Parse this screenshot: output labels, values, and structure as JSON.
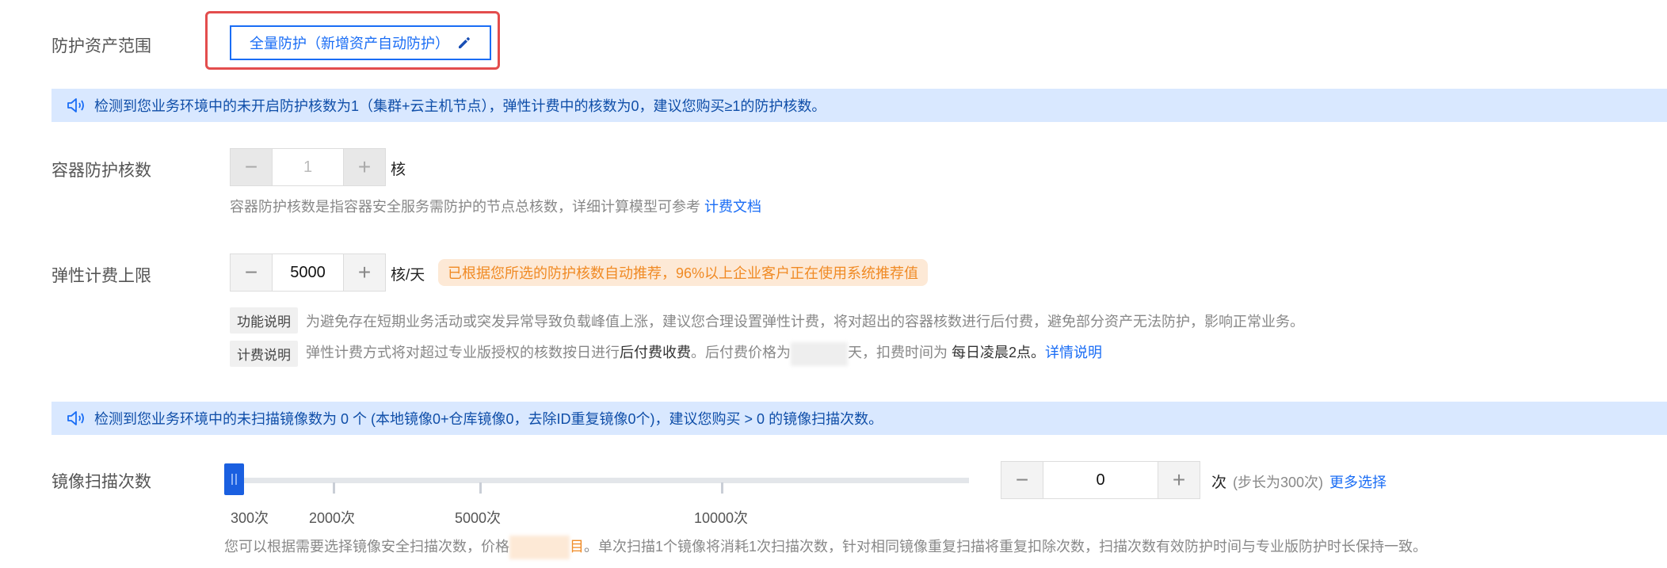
{
  "scope": {
    "label": "防护资产范围",
    "button_label": "全量防护（新增资产自动防护）"
  },
  "notice1": {
    "text": "检测到您业务环境中的未开启防护核数为1（集群+云主机节点），弹性计费中的核数为0，建议您购买≥1的防护核数。"
  },
  "container_cores": {
    "label": "容器防护核数",
    "value": "1",
    "unit": "核",
    "hint": "容器防护核数是指容器安全服务需防护的节点总核数，详细计算模型可参考",
    "hint_link": "计费文档"
  },
  "elastic": {
    "label": "弹性计费上限",
    "value": "5000",
    "unit": "核/天",
    "badge": "已根据您所选的防护核数自动推荐，96%以上企业客户正在使用系统推荐值",
    "func_tag": "功能说明",
    "func_text": "为避免存在短期业务活动或突发异常导致负载峰值上涨，建议您合理设置弹性计费，将对超出的容器核数进行后付费，避免部分资产无法防护，影响正常业务。",
    "billing_tag": "计费说明",
    "billing_text_1": "弹性计费方式将对超过专业版授权的核数按日进行",
    "billing_bold_1": "后付费收费",
    "billing_text_2": "。后付费价格为",
    "billing_text_3": "天，扣费时间为",
    "billing_bold_2": "每日凌晨2点",
    "billing_text_4": "。",
    "billing_link": "详情说明"
  },
  "notice2": {
    "text": "检测到您业务环境中的未扫描镜像数为 0 个 (本地镜像0+仓库镜像0，去除ID重复镜像0个)，建议您购买 > 0 的镜像扫描次数。"
  },
  "scan": {
    "label": "镜像扫描次数",
    "slider_value": 0,
    "ticks": [
      "300次",
      "2000次",
      "5000次",
      "10000次"
    ],
    "value": "0",
    "unit": "次",
    "step_hint": "(步长为300次)",
    "more_link": "更多选择",
    "hint_1": "您可以根据需要选择镜像安全扫描次数，价格",
    "hint_price_tail": "目",
    "hint_2": "。单次扫描1个镜像将消耗1次扫描次数，针对相同镜像重复扫描将重复扣除次数，扫描次数有效防护时间与专业版防护时长保持一致。"
  },
  "colors": {
    "primary": "#1a6df5",
    "notice_bg": "#d9e8ff",
    "warning": "#f08a24",
    "highlight_border": "#e34d4d"
  }
}
